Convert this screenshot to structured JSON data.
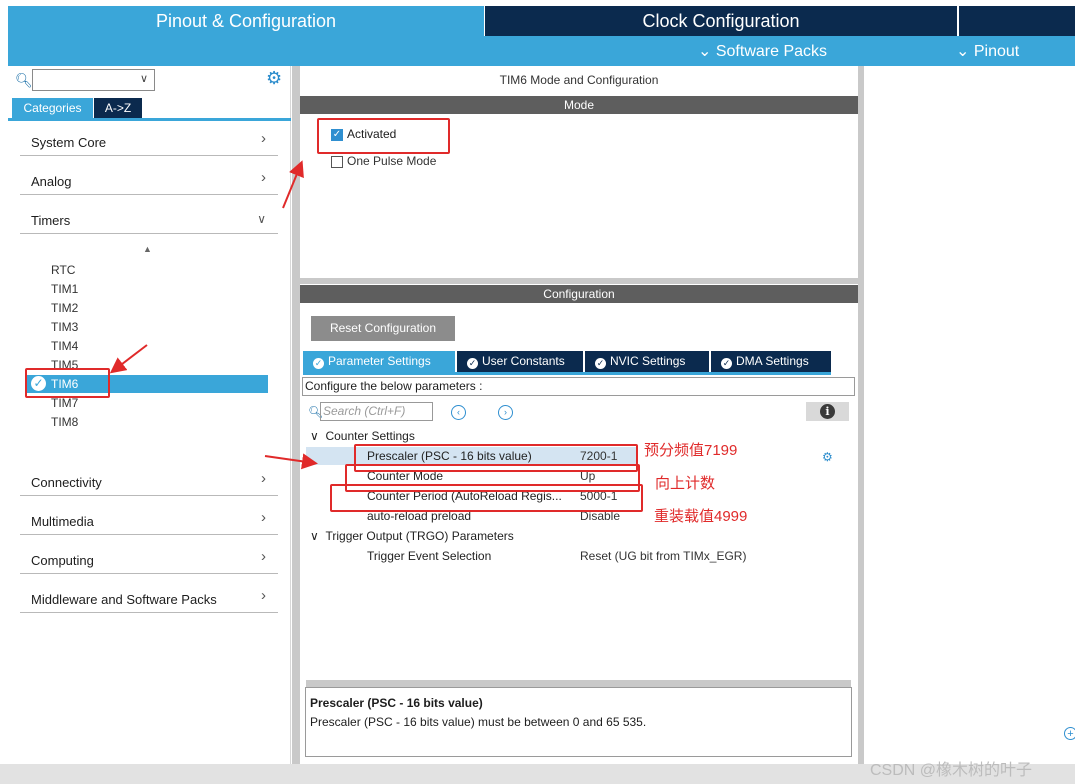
{
  "top_tabs": {
    "pinout_config": "Pinout & Configuration",
    "clock_config": "Clock Configuration",
    "software_packs": "Software Packs",
    "pinout": "Pinout"
  },
  "left": {
    "tab_categories": "Categories",
    "tab_az": "A->Z",
    "categories": {
      "system_core": "System Core",
      "analog": "Analog",
      "timers": "Timers",
      "connectivity": "Connectivity",
      "multimedia": "Multimedia",
      "computing": "Computing",
      "middleware": "Middleware and Software Packs"
    },
    "timers": [
      "RTC",
      "TIM1",
      "TIM2",
      "TIM3",
      "TIM4",
      "TIM5",
      "TIM6",
      "TIM7",
      "TIM8"
    ]
  },
  "mode": {
    "title": "TIM6 Mode and Configuration",
    "header": "Mode",
    "activated": "Activated",
    "one_pulse": "One Pulse Mode",
    "activated_checked": true,
    "one_pulse_checked": false
  },
  "config": {
    "header": "Configuration",
    "reset_button": "Reset Configuration",
    "tabs": [
      "Parameter Settings",
      "User Constants",
      "NVIC Settings",
      "DMA Settings"
    ],
    "configure_label": "Configure the below parameters :",
    "search_placeholder": "Search (Ctrl+F)",
    "groups": {
      "counter": "Counter Settings",
      "trgo": "Trigger Output (TRGO) Parameters"
    },
    "params": {
      "prescaler": {
        "name": "Prescaler (PSC - 16 bits value)",
        "value": "7200-1"
      },
      "counter_mode": {
        "name": "Counter Mode",
        "value": "Up"
      },
      "counter_period": {
        "name": "Counter Period (AutoReload Regis...",
        "value": "5000-1"
      },
      "auto_reload": {
        "name": "auto-reload preload",
        "value": "Disable"
      },
      "trigger_event": {
        "name": "Trigger Event Selection",
        "value": "Reset (UG bit from TIMx_EGR)"
      }
    }
  },
  "description": {
    "title": "Prescaler (PSC - 16 bits value)",
    "text": "Prescaler (PSC - 16 bits value) must be between 0 and 65 535."
  },
  "annotations": {
    "prescaler_note": "预分频值7199",
    "mode_note": "向上计数",
    "period_note": "重装载值4999",
    "color": "#e02a2a"
  },
  "watermark": "CSDN @橡木树的叶子",
  "colors": {
    "accent_blue": "#3aa6d9",
    "dark_navy": "#0b2a4e",
    "section_gray": "#5e5e5e"
  }
}
